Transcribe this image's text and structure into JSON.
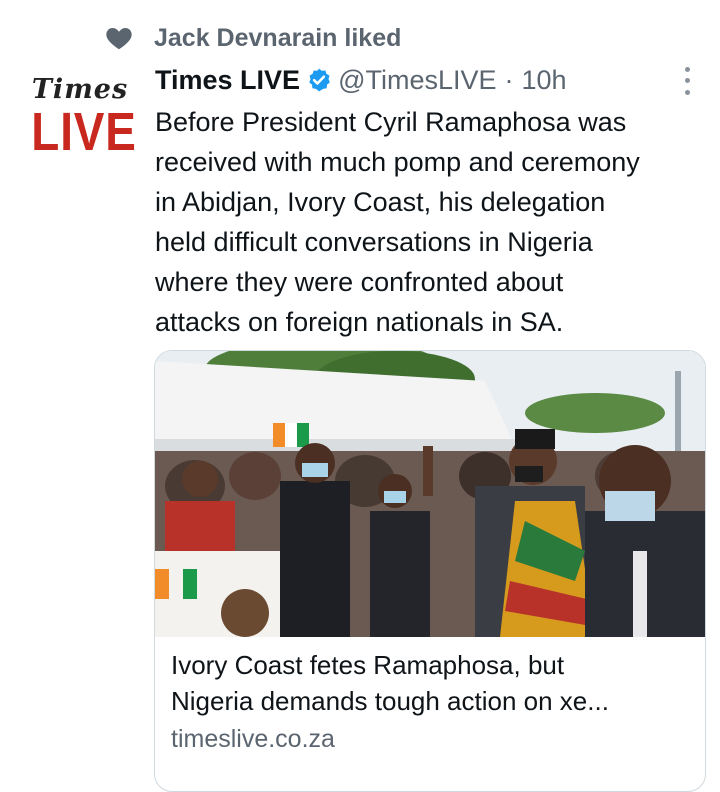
{
  "social_context": {
    "icon": "heart-icon",
    "text": "Jack Devnarain liked"
  },
  "avatar": {
    "line1": "Times",
    "line2": "LIVE"
  },
  "tweet": {
    "author_name": "Times LIVE",
    "verified_icon": "verified-badge-icon",
    "handle": "@TimesLIVE",
    "separator": "·",
    "time": "10h",
    "text_lines": [
      "Before President Cyril Ramaphosa was",
      "received with much pomp and ceremony",
      "in Abidjan, Ivory Coast, his delegation",
      "held difficult conversations in Nigeria",
      "where they were confronted about",
      "attacks on foreign nationals in SA."
    ]
  },
  "card": {
    "title_line1": "Ivory Coast fetes Ramaphosa, but",
    "title_line2": "Nigeria demands tough action on xe...",
    "domain": "timeslive.co.za"
  },
  "colors": {
    "secondary_text": "#5b6570",
    "verified_blue": "#1d9bf0",
    "live_red": "#c8281e"
  }
}
